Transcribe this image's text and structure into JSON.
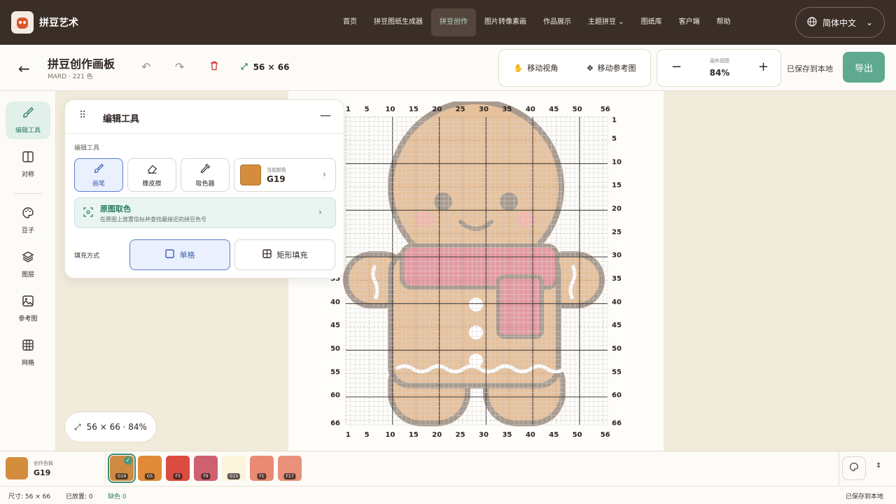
{
  "nav": {
    "brand": "拼豆艺术",
    "links": [
      "首页",
      "拼豆图纸生成器",
      "拼豆创作",
      "图片转像素画",
      "作品展示",
      "主题拼豆",
      "图纸库",
      "客户端",
      "帮助"
    ],
    "active_index": 2,
    "language": "简体中文"
  },
  "toolbar": {
    "title": "拼豆创作画板",
    "subtitle": "MARD · 221 色",
    "canvas_size": "56 × 66",
    "pan_view": "移动视角",
    "pan_reference": "移动参考图",
    "zoom_caption": "画布视图",
    "zoom_value": "84%",
    "saved": "已保存到本地",
    "export": "导出"
  },
  "sidebar": {
    "items": [
      {
        "label": "编辑工具",
        "icon": "brush-icon"
      },
      {
        "label": "对称",
        "icon": "symmetry-icon"
      },
      {
        "label": "豆子",
        "icon": "palette-icon"
      },
      {
        "label": "图层",
        "icon": "layers-icon"
      },
      {
        "label": "参考图",
        "icon": "image-icon"
      },
      {
        "label": "网格",
        "icon": "grid-icon"
      }
    ]
  },
  "edit_panel": {
    "title": "编辑工具",
    "section_label": "编辑工具",
    "tools": [
      "画笔",
      "橡皮擦",
      "吸色器"
    ],
    "current_color_caption": "当前颜色",
    "current_color_code": "G19",
    "pick_title": "原图取色",
    "pick_desc": "在原图上放置信标并查找最接近的拼豆色号",
    "fill_label": "填充方式",
    "fill_single": "单格",
    "fill_rect": "矩形填充"
  },
  "size_chip": "56 × 66 · 84%",
  "grid": {
    "cols": 56,
    "rows": 66,
    "x_ticks": [
      "1",
      "5",
      "10",
      "15",
      "20",
      "25",
      "30",
      "35",
      "40",
      "45",
      "50",
      "56"
    ],
    "y_ticks": [
      "1",
      "5",
      "10",
      "15",
      "20",
      "25",
      "30",
      "35",
      "40",
      "45",
      "50",
      "55",
      "60",
      "66"
    ]
  },
  "palette": {
    "caption": "创作色板",
    "current": "G19",
    "colors": [
      {
        "code": "G19",
        "hex": "#cf8a3f"
      },
      {
        "code": "G5",
        "hex": "#e08a3a"
      },
      {
        "code": "F3",
        "hex": "#dc4b40"
      },
      {
        "code": "F9",
        "hex": "#cf6070"
      },
      {
        "code": "G15",
        "hex": "#fdf4dc"
      },
      {
        "code": "F1",
        "hex": "#ea8a74"
      },
      {
        "code": "F17",
        "hex": "#e9917a"
      }
    ]
  },
  "status": {
    "size": "尺寸: 56 × 66",
    "placed": "已放置: 0",
    "missing": "缺色 0",
    "saved": "已保存到本地"
  },
  "colors": {
    "nav_bg": "#3b2e26",
    "accent": "#5fa991",
    "bead_main": "#d38d3d"
  }
}
